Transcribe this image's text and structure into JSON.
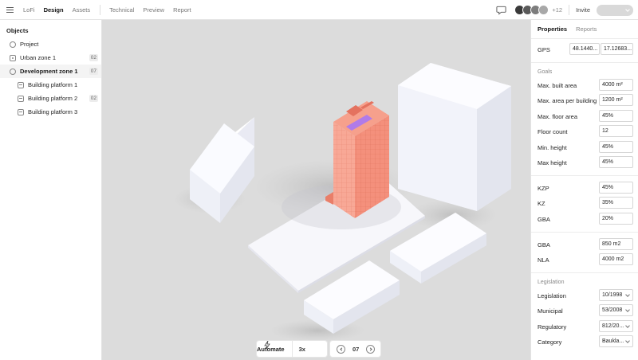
{
  "topbar": {
    "left_tabs": [
      {
        "label": "LoFi",
        "active": false
      },
      {
        "label": "Design",
        "active": true
      },
      {
        "label": "Assets",
        "active": false
      }
    ],
    "mode_tabs": [
      {
        "label": "Technical"
      },
      {
        "label": "Preview"
      },
      {
        "label": "Report"
      }
    ],
    "collaborators": [
      {
        "icon": "avatar",
        "color": "#3a3a3a"
      },
      {
        "icon": "avatar",
        "color": "#5a5a5a"
      },
      {
        "icon": "avatar",
        "color": "#7d7d7d"
      },
      {
        "icon": "avatar",
        "color": "#a8a8a8"
      }
    ],
    "more_count": "+12",
    "invite_label": "Invite"
  },
  "objects": {
    "title": "Objects",
    "items": [
      {
        "label": "Project",
        "icon": "circle-icon",
        "badge": "",
        "selected": false,
        "child": false
      },
      {
        "label": "Urban zone 1",
        "icon": "zone-icon",
        "badge": "02",
        "selected": false,
        "child": false
      },
      {
        "label": "Development zone 1",
        "icon": "circle-icon",
        "badge": "07",
        "selected": true,
        "child": false
      },
      {
        "label": "Building platform 1",
        "icon": "platform-icon",
        "badge": "",
        "selected": false,
        "child": true
      },
      {
        "label": "Building platform 2",
        "icon": "platform-icon",
        "badge": "02",
        "selected": false,
        "child": true
      },
      {
        "label": "Building platform 3",
        "icon": "platform-icon",
        "badge": "",
        "selected": false,
        "child": true
      }
    ]
  },
  "toolbar": {
    "automate_label": "Automate",
    "speed": "3x",
    "step": "07"
  },
  "properties": {
    "tabs": [
      {
        "label": "Properties",
        "active": true
      },
      {
        "label": "Reports",
        "active": false
      }
    ],
    "gps": {
      "label": "GPS",
      "lat": "48.1440...",
      "lon": "17.12683..."
    },
    "goals_heading": "Goals",
    "goals": [
      {
        "label": "Max. built area",
        "value": "4000 m²"
      },
      {
        "label": "Max. area per building",
        "value": "1200 m²"
      },
      {
        "label": "Max. floor area",
        "value": "45%"
      },
      {
        "label": "Floor count",
        "value": "12"
      },
      {
        "label": "Min. height",
        "value": "45%"
      },
      {
        "label": "Max height",
        "value": "45%"
      }
    ],
    "ratios": [
      {
        "label": "KZP",
        "value": "45%"
      },
      {
        "label": "KZ",
        "value": "35%"
      },
      {
        "label": "GBA",
        "value": "20%"
      }
    ],
    "areas": [
      {
        "label": "GBA",
        "value": "850 m2"
      },
      {
        "label": "NLA",
        "value": "4000 m2"
      }
    ],
    "legislation_heading": "Legislation",
    "legislation": [
      {
        "label": "Legislation",
        "value": "10/1998"
      },
      {
        "label": "Municipal",
        "value": "53/2008"
      },
      {
        "label": "Regulatory",
        "value": "812/20..."
      },
      {
        "label": "Category",
        "value": "Baukla..."
      }
    ]
  },
  "colors": {
    "viewport_bg": "#dcdcdc",
    "tower": "#f3907c",
    "tower_roof_accent": "#b07be8",
    "block": "#f3f4fb"
  }
}
